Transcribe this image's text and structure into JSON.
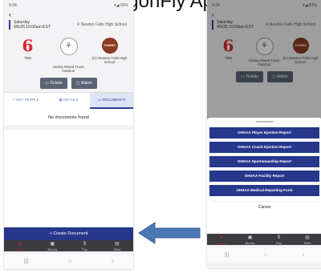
{
  "title": "DragonFly App",
  "status": {
    "time": "9:34",
    "indicators": "▾◢ 83%"
  },
  "event": {
    "day": "Saturday",
    "datetime": "4/5/25 10:00am EST",
    "venue": "Newton Falls High School",
    "away_team": "TBD",
    "sport": "Varsity Mixed Track, Outdoor",
    "home_team": "(H) Newton Falls High School",
    "home_logo_text": "TIGERS",
    "tickets_label": "Tickets",
    "watch_label": "Watch"
  },
  "tabs": [
    {
      "label": "KEY PEOPLE",
      "icon": "people-icon"
    },
    {
      "label": "DETAILS",
      "icon": "calendar-icon"
    },
    {
      "label": "DOCUMENTS",
      "icon": "folder-icon",
      "active": true
    }
  ],
  "empty_message": "No documents found",
  "create_label": "+ Create Document",
  "bottom_nav": [
    {
      "label": "Events",
      "icon": "events-icon",
      "glyph": "●"
    },
    {
      "label": "Blocks",
      "icon": "blocks-icon",
      "glyph": "▣"
    },
    {
      "label": "Pay",
      "icon": "pay-icon",
      "glyph": "$"
    },
    {
      "label": "Slate",
      "icon": "slate-icon",
      "glyph": "▤"
    }
  ],
  "system_nav": [
    "|||",
    "○",
    "‹"
  ],
  "sheet": {
    "reports": [
      "OHSAA Player Ejection Report",
      "OHSAA Coach Ejection Report",
      "OHSAA Sportsmanship Report",
      "OHSAA Facility Report",
      "OHSAA Medical Reporting Form"
    ],
    "cancel_label": "Cancel"
  },
  "colors": {
    "primary": "#27378c",
    "accent": "#d9262b",
    "arrow": "#4a78b5"
  }
}
